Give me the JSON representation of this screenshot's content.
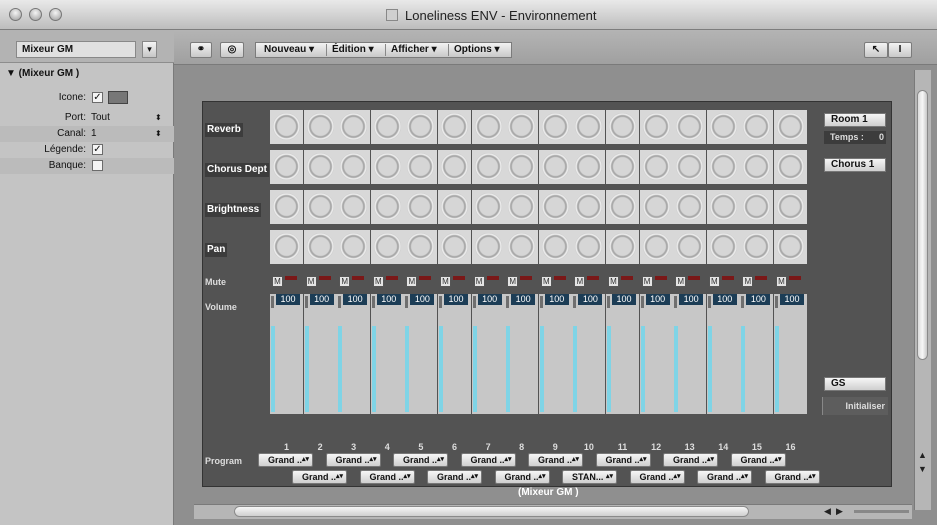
{
  "window": {
    "title": "Loneliness ENV - Environnement"
  },
  "inspector": {
    "layer_select": "Mixeur GM",
    "object_title": "▼ (Mixeur GM )",
    "fields": {
      "icon_label": "Icone:",
      "icon_checked": "✓",
      "port_label": "Port:",
      "port_value": "Tout",
      "channel_label": "Canal:",
      "channel_value": "1",
      "legend_label": "Légende:",
      "legend_checked": "✓",
      "bank_label": "Banque:"
    }
  },
  "toolbar": {
    "menus": [
      "Nouveau",
      "Édition",
      "Afficher",
      "Options"
    ]
  },
  "mixer": {
    "name": "(Mixeur GM )",
    "row_labels": {
      "reverb": "Reverb",
      "chorus": "Chorus Dept",
      "brightness": "Brightness",
      "pan": "Pan",
      "mute": "Mute",
      "volume": "Volume",
      "program": "Program"
    },
    "mute_label": "M",
    "channels": [
      "1",
      "2",
      "3",
      "4",
      "5",
      "6",
      "7",
      "8",
      "9",
      "10",
      "11",
      "12",
      "13",
      "14",
      "15",
      "16"
    ],
    "volumes": [
      "100",
      "100",
      "100",
      "100",
      "100",
      "100",
      "100",
      "100",
      "100",
      "100",
      "100",
      "100",
      "100",
      "100",
      "100",
      "100"
    ],
    "programs_odd": [
      "Grand ..",
      "Grand ..",
      "Grand ..",
      "Grand ..",
      "Grand ..",
      "Grand ..",
      "Grand ..",
      "Grand .."
    ],
    "programs_even": [
      "Grand ..",
      "Grand ..",
      "Grand ..",
      "Grand ..",
      "STAN...",
      "Grand ..",
      "Grand ..",
      "Grand .."
    ],
    "right_panel": {
      "reverb_type": "Room 1",
      "temps_label": "Temps :",
      "temps_value": "0",
      "chorus_type": "Chorus 1",
      "mode": "GS",
      "reset": "Initialiser"
    }
  },
  "colors": {
    "canvas": "#535353",
    "volume_display": "#1c3d56",
    "fader_slot": "#7fd4e6",
    "mute_led": "#7a1818"
  }
}
